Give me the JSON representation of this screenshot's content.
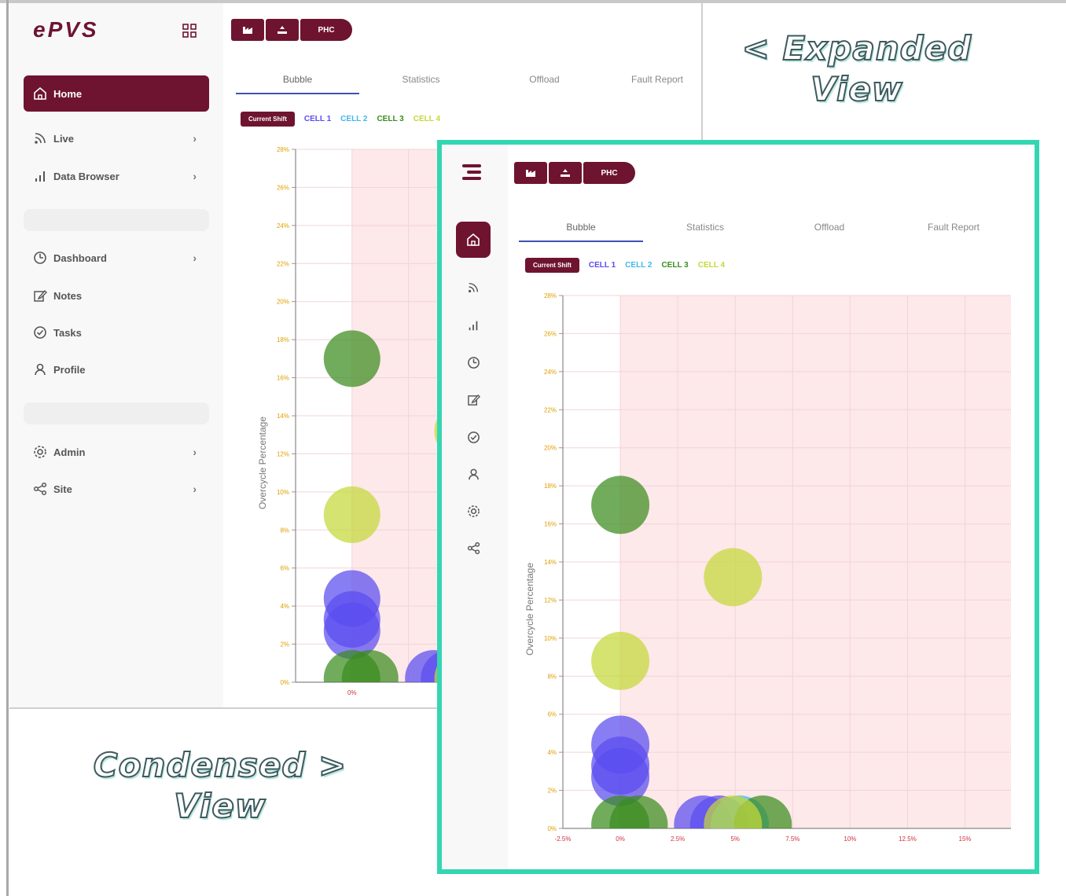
{
  "app": {
    "logo": "ePVS"
  },
  "colors": {
    "brand": "#6e1430",
    "highlight": "#33d6b3",
    "cell1": "#5a4cf0",
    "cell2": "#41b8e8",
    "cell3": "#3a8c1e",
    "cell4": "#c5d839"
  },
  "sidebar": {
    "items": [
      {
        "label": "Home",
        "icon": "home-icon",
        "chevron": ""
      },
      {
        "label": "Live",
        "icon": "rss-icon",
        "chevron": "›"
      },
      {
        "label": "Data Browser",
        "icon": "bar-chart-icon",
        "chevron": "›"
      },
      {
        "label": "Dashboard",
        "icon": "gauge-icon",
        "chevron": "›"
      },
      {
        "label": "Notes",
        "icon": "edit-icon",
        "chevron": ""
      },
      {
        "label": "Tasks",
        "icon": "check-circle-icon",
        "chevron": ""
      },
      {
        "label": "Profile",
        "icon": "user-icon",
        "chevron": ""
      },
      {
        "label": "Admin",
        "icon": "gear-icon",
        "chevron": "›"
      },
      {
        "label": "Site",
        "icon": "share-icon",
        "chevron": "›"
      }
    ]
  },
  "toolbar": {
    "button3_label": "PHC"
  },
  "tabs": [
    "Bubble",
    "Statistics",
    "Offload",
    "Fault Report"
  ],
  "legend": {
    "current_shift": "Current Shift",
    "cells": [
      "CELL 1",
      "CELL 2",
      "CELL 3",
      "CELL 4"
    ]
  },
  "captions": {
    "expanded_line1": "< Expanded",
    "expanded_line2": "View",
    "condensed_line1": "Condensed >",
    "condensed_line2": "View"
  },
  "chart_data": {
    "type": "scatter",
    "ylabel": "Overcycle Percentage",
    "y_ticks": [
      "0%",
      "2%",
      "4%",
      "6%",
      "8%",
      "10%",
      "12%",
      "14%",
      "16%",
      "18%",
      "20%",
      "22%",
      "24%",
      "26%",
      "28%"
    ],
    "x_ticks": [
      "-2.5%",
      "0%",
      "2.5%",
      "5%",
      "7.5%",
      "10%",
      "12.5%",
      "15%"
    ],
    "ylim": [
      0,
      28
    ],
    "xlim": [
      -2.5,
      17
    ],
    "grid": true,
    "series": [
      {
        "name": "CELL 1",
        "color": "#5a4cf0",
        "points": [
          [
            0,
            4.4
          ],
          [
            0,
            3.3
          ],
          [
            0,
            2.7
          ],
          [
            3.6,
            0.2
          ],
          [
            4.3,
            0.2
          ]
        ]
      },
      {
        "name": "CELL 2",
        "color": "#41b8e8",
        "points": [
          [
            5.2,
            0.2
          ]
        ]
      },
      {
        "name": "CELL 3",
        "color": "#3a8c1e",
        "points": [
          [
            0,
            17
          ],
          [
            0,
            0.2
          ],
          [
            0.8,
            0.2
          ],
          [
            6.2,
            0.2
          ]
        ]
      },
      {
        "name": "CELL 4",
        "color": "#c5d839",
        "points": [
          [
            4.9,
            13.2
          ],
          [
            0,
            8.8
          ],
          [
            4.9,
            0.2
          ]
        ]
      }
    ]
  }
}
